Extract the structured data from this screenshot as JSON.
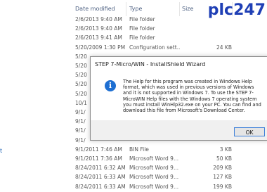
{
  "watermark": "plc247",
  "left_pane": {
    "glyph": "t"
  },
  "columns": {
    "date": "Date modified",
    "type": "Type",
    "size": "Size"
  },
  "rows": [
    {
      "date": "2/6/2013 9:40 AM",
      "type": "File folder",
      "size": ""
    },
    {
      "date": "2/6/2013 9:40 AM",
      "type": "File folder",
      "size": ""
    },
    {
      "date": "2/6/2013 9:41 AM",
      "type": "File folder",
      "size": ""
    },
    {
      "date": "5/20/2009 1:30 PM",
      "type": "Configuration sett...",
      "size": "24 KB"
    },
    {
      "date": "5/20",
      "type": "",
      "size": ""
    },
    {
      "date": "5/20",
      "type": "",
      "size": ""
    },
    {
      "date": "5/20",
      "type": "",
      "size": ""
    },
    {
      "date": "5/20",
      "type": "",
      "size": ""
    },
    {
      "date": "5/20",
      "type": "",
      "size": ""
    },
    {
      "date": "10/1",
      "type": "",
      "size": ""
    },
    {
      "date": "9/1/",
      "type": "",
      "size": ""
    },
    {
      "date": "9/1/",
      "type": "",
      "size": ""
    },
    {
      "date": "9/1/",
      "type": "",
      "size": ""
    },
    {
      "date": "9/1/",
      "type": "",
      "size": ""
    },
    {
      "date": "9/1/2011 7:46 AM",
      "type": "BIN File",
      "size": "3 KB"
    },
    {
      "date": "9/1/2011 7:36 AM",
      "type": "Microsoft Word 9...",
      "size": "50 KB"
    },
    {
      "date": "8/24/2011 6:32 AM",
      "type": "Microsoft Word 9...",
      "size": "209 KB"
    },
    {
      "date": "8/24/2011 6:33 AM",
      "type": "Microsoft Word 9...",
      "size": "127 KB"
    },
    {
      "date": "8/24/2011 6:33 AM",
      "type": "Microsoft Word 9...",
      "size": "199 KB"
    }
  ],
  "dialog": {
    "title": "STEP 7-Micro/WIN - InstallShield Wizard",
    "icon": "info-icon",
    "message": "The Help for this program was created in Windows Help format, which was used in previous versions of Windows and it is not supported in Windows 7.  To use the STEP 7-MicroWIN Help files with the Windows 7 operating system you must install WinHlp32.exe on your PC.  You can find and download this file from Microsoft's Download Center.",
    "ok_label": "OK"
  }
}
